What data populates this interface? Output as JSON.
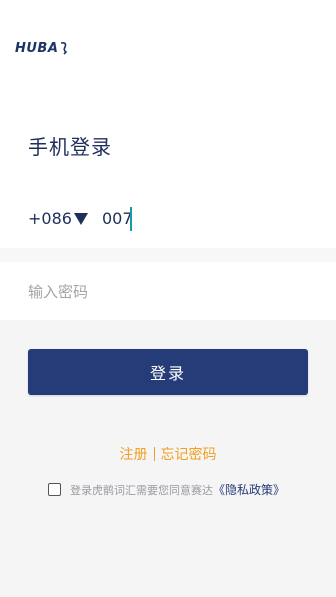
{
  "logo": {
    "text": "HUBA"
  },
  "page": {
    "title": "手机登录"
  },
  "phone": {
    "country_code": "+086",
    "value": "007"
  },
  "password": {
    "placeholder": "输入密码"
  },
  "login": {
    "label": "登录"
  },
  "links": {
    "register": "注册",
    "forgot": "忘记密码"
  },
  "agreement": {
    "text": "登录虎鹡词汇需要您同意赛达",
    "policy": "《隐私政策》",
    "checked": false
  },
  "colors": {
    "primary": "#253c78",
    "accent": "#f0a020",
    "caret": "#1a9aa8",
    "background": "#f5f5f6"
  }
}
